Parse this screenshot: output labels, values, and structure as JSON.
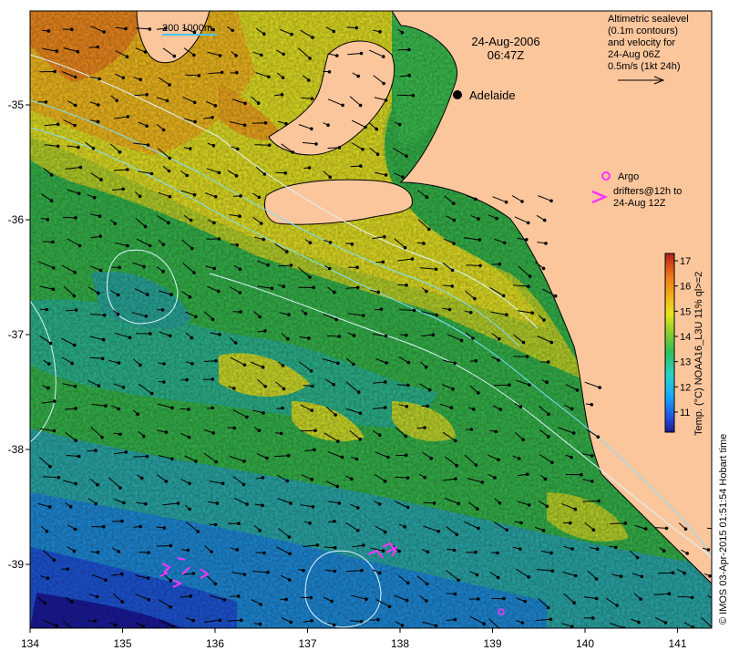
{
  "map": {
    "date": "24-Aug-2006",
    "time": "06:47Z",
    "scale_label": "200  1000m",
    "city": "Adelaide",
    "legend": {
      "lines": [
        "Altimetric sealevel",
        "(0.1m contours)",
        "and velocity for",
        "24-Aug 06Z",
        "0.5m/s (1kt 24h)"
      ]
    },
    "argo": {
      "label": "Argo",
      "drifter_lines": [
        "drifters@12h to",
        "24-Aug 12Z"
      ]
    },
    "colorbar": {
      "label": "Temp. (°C) NOAA16_L3U 11% ql>=2",
      "ticks": [
        "11",
        "12",
        "13",
        "14",
        "15",
        "16",
        "17"
      ],
      "colors": [
        "#1a1a8c",
        "#1f4fe0",
        "#18a8ff",
        "#28d2c8",
        "#2fbf5a",
        "#8ccf2a",
        "#e6e61e",
        "#f2b21a",
        "#ee7f1c",
        "#d8461a",
        "#a52218"
      ]
    },
    "credit": "© IMOS 03-Apr-2015 01:51:54 Hobart time",
    "x_ticks": [
      "134",
      "135",
      "136",
      "137",
      "138",
      "139",
      "140",
      "141"
    ],
    "y_ticks": [
      "-35",
      "-36",
      "-37",
      "-38",
      "-39"
    ],
    "colors": {
      "land": "#fbc69c",
      "contour": "#dff5ff",
      "shelf": "#7fe0ff",
      "argo": "#ff33ff"
    }
  }
}
